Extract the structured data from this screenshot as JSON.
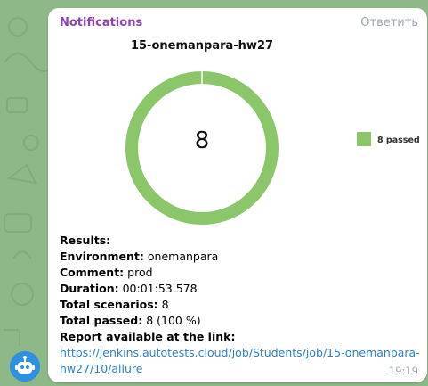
{
  "message": {
    "sender": "Notifications",
    "reply_label": "Ответить",
    "time": "19:19"
  },
  "chart_data": {
    "type": "pie",
    "title": "15-onemanpara-hw27",
    "center_label": "8",
    "categories": [
      "8 passed"
    ],
    "values": [
      8
    ],
    "colors": [
      "#8bc66b"
    ],
    "legend_position": "right"
  },
  "results": {
    "heading": "Results:",
    "lines": [
      {
        "label": "Environment:",
        "value": "onemanpara"
      },
      {
        "label": "Comment:",
        "value": "prod"
      },
      {
        "label": "Duration:",
        "value": "00:01:53.578"
      },
      {
        "label": "Total scenarios:",
        "value": "8"
      },
      {
        "label": "Total passed:",
        "value": "8 (100 %)"
      }
    ],
    "report_label": "Report available at the link:",
    "report_link_line1": "https://jenkins.autotests.cloud/job/Students/job/15-onemanpara-",
    "report_link_line2": "hw27/10/allure"
  },
  "icons": {
    "avatar": "robot-avatar-icon"
  }
}
